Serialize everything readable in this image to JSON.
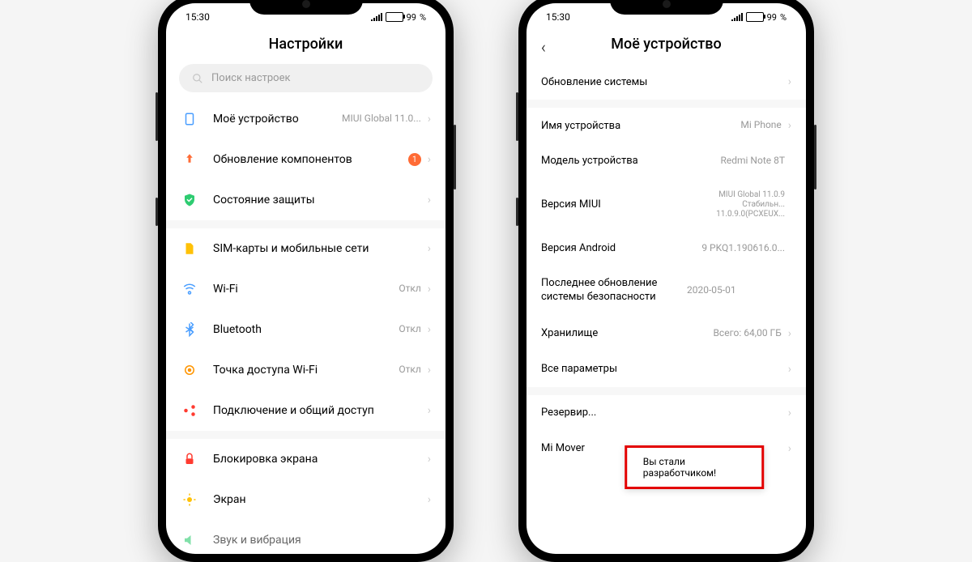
{
  "status": {
    "time": "15:30",
    "battery": "99"
  },
  "phone1": {
    "title": "Настройки",
    "search_placeholder": "Поиск настроек",
    "rows": {
      "my_device": {
        "label": "Моё устройство",
        "value": "MIUI Global 11.0..."
      },
      "components": {
        "label": "Обновление компонентов",
        "badge": "1"
      },
      "security": {
        "label": "Состояние защиты"
      },
      "sim": {
        "label": "SIM-карты и мобильные сети"
      },
      "wifi": {
        "label": "Wi-Fi",
        "value": "Откл"
      },
      "bluetooth": {
        "label": "Bluetooth",
        "value": "Откл"
      },
      "hotspot": {
        "label": "Точка доступа Wi-Fi",
        "value": "Откл"
      },
      "sharing": {
        "label": "Подключение и общий доступ"
      },
      "lock": {
        "label": "Блокировка экрана"
      },
      "display": {
        "label": "Экран"
      },
      "sound": {
        "label": "Звук и вибрация"
      }
    }
  },
  "phone2": {
    "title": "Моё устройство",
    "rows": {
      "system_update": {
        "label": "Обновление системы"
      },
      "device_name": {
        "label": "Имя устройства",
        "value": "Mi Phone"
      },
      "model": {
        "label": "Модель устройства",
        "value": "Redmi Note 8T"
      },
      "miui": {
        "label": "Версия MIUI",
        "value1": "MIUI Global 11.0.9",
        "value2": "Стабильн...",
        "value3": "11.0.9.0(PCXEUX..."
      },
      "android": {
        "label": "Версия Android",
        "value": "9 PKQ1.190616.0..."
      },
      "security_patch": {
        "label": "Последнее обновление системы безопасности",
        "value": "2020-05-01"
      },
      "storage": {
        "label": "Хранилище",
        "value": "Всего: 64,00 ГБ"
      },
      "all_params": {
        "label": "Все параметры"
      },
      "backup": {
        "label": "Резервир..."
      },
      "mimover": {
        "label": "Mi Mover"
      }
    },
    "toast": "Вы стали разработчиком!"
  }
}
